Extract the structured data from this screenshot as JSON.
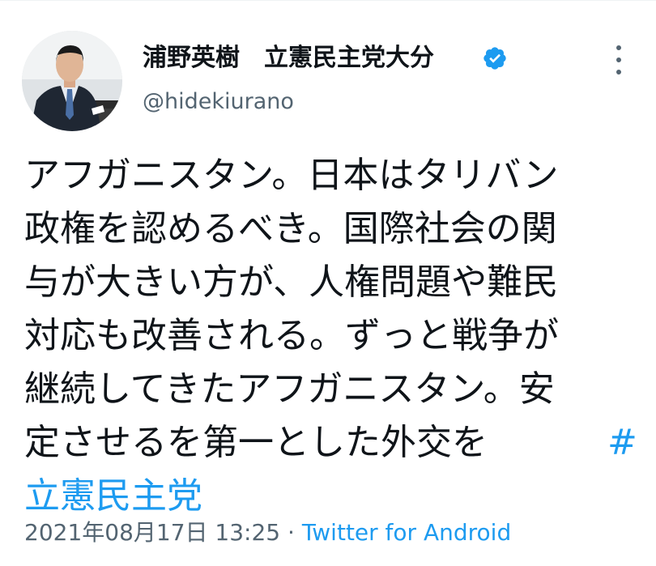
{
  "author": {
    "display_name": "浦野英樹　立憲民主党大分",
    "handle": "@hidekiurano",
    "verified_icon": "verified-badge-icon",
    "avatar_icon": "profile-photo"
  },
  "more_icon": "more-options-icon",
  "tweet": {
    "lines": [
      "アフガニスタン。日本はタリバン",
      "政権を認めるべき。国際社会の関",
      "与が大きい方が、人権問題や難民",
      "対応も改善される。ずっと戦争が",
      "継続してきたアフガニスタン。安",
      "定させるを第一とした外交を"
    ],
    "hashtag_prefix": "#",
    "hashtag_text": "立憲民主党"
  },
  "meta": {
    "timestamp": "2021年08月17日 13:25",
    "separator": " · ",
    "source": "Twitter for Android"
  },
  "colors": {
    "link": "#1d9bf0",
    "secondary_text": "#536471",
    "primary_text": "#0f1419",
    "verified": "#1d9bf0"
  }
}
